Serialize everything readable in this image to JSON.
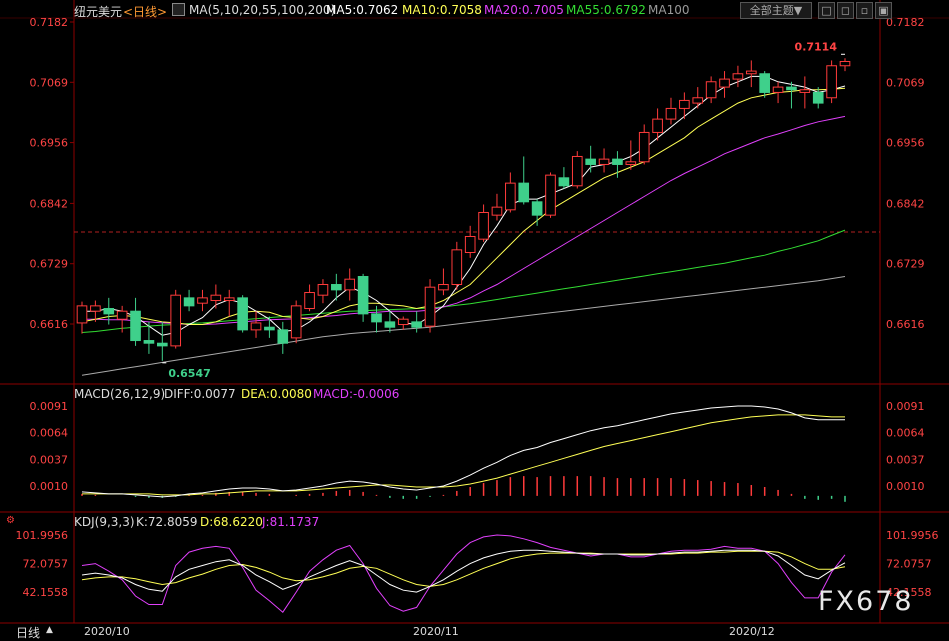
{
  "header": {
    "symbol_label": "纽元美元",
    "period_label": "<日线>",
    "ma_params": "MA(5,10,20,55,100,200)",
    "ma5": "MA5:0.7062",
    "ma10": "MA10:0.7058",
    "ma20": "MA20:0.7005",
    "ma55": "MA55:0.6792",
    "ma100": "MA100",
    "theme_button": "全部主题▼",
    "win_buttons": [
      "□",
      "◻",
      "▫",
      "▣"
    ]
  },
  "price_axis": [
    "0.7182",
    "0.7069",
    "0.6956",
    "0.6842",
    "0.6729",
    "0.6616"
  ],
  "annotations": {
    "high": "0.7114",
    "low": "0.6547"
  },
  "macd": {
    "title": "MACD(26,12,9)",
    "diff": "DIFF:0.0077",
    "dea": "DEA:0.0080",
    "macd": "MACD:-0.0006",
    "axis": [
      "0.0091",
      "0.0064",
      "0.0037",
      "0.0010"
    ]
  },
  "kdj": {
    "title": "KDJ(9,3,3)",
    "k": "K:72.8059",
    "d": "D:68.6220",
    "j": "J:81.1737",
    "axis": [
      "101.9956",
      "72.0757",
      "42.1558"
    ]
  },
  "bottom": {
    "period_tab": "日线",
    "dates": [
      "2020/10",
      "2020/11",
      "2020/12"
    ]
  },
  "watermark": "FX678",
  "colors": {
    "up": "#ff3b3b",
    "down": "#3fd08b",
    "ma5": "#ffffff",
    "ma10": "#ffff55",
    "ma20": "#e040fb",
    "ma55": "#33dd33",
    "ma100": "#aaaaaa"
  },
  "chart_data": {
    "type": "candlestick",
    "x_range": [
      "2020/10",
      "2020/12"
    ],
    "price_range": [
      0.6547,
      0.7182
    ],
    "candles": [
      {
        "o": 0.6618,
        "h": 0.6658,
        "l": 0.6598,
        "c": 0.665
      },
      {
        "o": 0.664,
        "h": 0.666,
        "l": 0.662,
        "c": 0.665
      },
      {
        "o": 0.6645,
        "h": 0.6665,
        "l": 0.6615,
        "c": 0.6635
      },
      {
        "o": 0.6625,
        "h": 0.665,
        "l": 0.66,
        "c": 0.664
      },
      {
        "o": 0.664,
        "h": 0.6665,
        "l": 0.6575,
        "c": 0.6585
      },
      {
        "o": 0.6585,
        "h": 0.662,
        "l": 0.656,
        "c": 0.658
      },
      {
        "o": 0.658,
        "h": 0.662,
        "l": 0.6547,
        "c": 0.6575
      },
      {
        "o": 0.6575,
        "h": 0.668,
        "l": 0.657,
        "c": 0.667
      },
      {
        "o": 0.6665,
        "h": 0.668,
        "l": 0.664,
        "c": 0.665
      },
      {
        "o": 0.6655,
        "h": 0.668,
        "l": 0.664,
        "c": 0.6665
      },
      {
        "o": 0.666,
        "h": 0.669,
        "l": 0.6645,
        "c": 0.667
      },
      {
        "o": 0.666,
        "h": 0.668,
        "l": 0.663,
        "c": 0.6665
      },
      {
        "o": 0.6665,
        "h": 0.667,
        "l": 0.66,
        "c": 0.6605
      },
      {
        "o": 0.6605,
        "h": 0.664,
        "l": 0.659,
        "c": 0.6618
      },
      {
        "o": 0.661,
        "h": 0.663,
        "l": 0.659,
        "c": 0.6605
      },
      {
        "o": 0.6605,
        "h": 0.662,
        "l": 0.656,
        "c": 0.658
      },
      {
        "o": 0.659,
        "h": 0.666,
        "l": 0.658,
        "c": 0.665
      },
      {
        "o": 0.6645,
        "h": 0.669,
        "l": 0.664,
        "c": 0.6675
      },
      {
        "o": 0.667,
        "h": 0.67,
        "l": 0.6655,
        "c": 0.669
      },
      {
        "o": 0.669,
        "h": 0.671,
        "l": 0.666,
        "c": 0.668
      },
      {
        "o": 0.668,
        "h": 0.672,
        "l": 0.666,
        "c": 0.67
      },
      {
        "o": 0.6705,
        "h": 0.671,
        "l": 0.662,
        "c": 0.6635
      },
      {
        "o": 0.6635,
        "h": 0.665,
        "l": 0.66,
        "c": 0.662
      },
      {
        "o": 0.662,
        "h": 0.664,
        "l": 0.66,
        "c": 0.661
      },
      {
        "o": 0.6615,
        "h": 0.663,
        "l": 0.6605,
        "c": 0.6625
      },
      {
        "o": 0.662,
        "h": 0.664,
        "l": 0.66,
        "c": 0.661
      },
      {
        "o": 0.6612,
        "h": 0.67,
        "l": 0.66,
        "c": 0.6685
      },
      {
        "o": 0.668,
        "h": 0.672,
        "l": 0.667,
        "c": 0.669
      },
      {
        "o": 0.669,
        "h": 0.677,
        "l": 0.668,
        "c": 0.6755
      },
      {
        "o": 0.675,
        "h": 0.68,
        "l": 0.674,
        "c": 0.678
      },
      {
        "o": 0.6775,
        "h": 0.684,
        "l": 0.677,
        "c": 0.6825
      },
      {
        "o": 0.682,
        "h": 0.686,
        "l": 0.681,
        "c": 0.6835
      },
      {
        "o": 0.683,
        "h": 0.69,
        "l": 0.6825,
        "c": 0.688
      },
      {
        "o": 0.688,
        "h": 0.693,
        "l": 0.684,
        "c": 0.6845
      },
      {
        "o": 0.6845,
        "h": 0.685,
        "l": 0.68,
        "c": 0.682
      },
      {
        "o": 0.682,
        "h": 0.69,
        "l": 0.6815,
        "c": 0.6895
      },
      {
        "o": 0.689,
        "h": 0.691,
        "l": 0.687,
        "c": 0.6875
      },
      {
        "o": 0.6875,
        "h": 0.694,
        "l": 0.687,
        "c": 0.693
      },
      {
        "o": 0.6925,
        "h": 0.695,
        "l": 0.69,
        "c": 0.6915
      },
      {
        "o": 0.6915,
        "h": 0.6945,
        "l": 0.69,
        "c": 0.6925
      },
      {
        "o": 0.6925,
        "h": 0.694,
        "l": 0.689,
        "c": 0.6915
      },
      {
        "o": 0.6915,
        "h": 0.696,
        "l": 0.6905,
        "c": 0.692
      },
      {
        "o": 0.692,
        "h": 0.699,
        "l": 0.6915,
        "c": 0.6975
      },
      {
        "o": 0.6975,
        "h": 0.702,
        "l": 0.696,
        "c": 0.7
      },
      {
        "o": 0.7,
        "h": 0.704,
        "l": 0.699,
        "c": 0.702
      },
      {
        "o": 0.702,
        "h": 0.705,
        "l": 0.7,
        "c": 0.7035
      },
      {
        "o": 0.703,
        "h": 0.706,
        "l": 0.702,
        "c": 0.704
      },
      {
        "o": 0.704,
        "h": 0.708,
        "l": 0.703,
        "c": 0.707
      },
      {
        "o": 0.706,
        "h": 0.709,
        "l": 0.704,
        "c": 0.7075
      },
      {
        "o": 0.7075,
        "h": 0.71,
        "l": 0.706,
        "c": 0.7085
      },
      {
        "o": 0.7085,
        "h": 0.711,
        "l": 0.706,
        "c": 0.709
      },
      {
        "o": 0.7085,
        "h": 0.709,
        "l": 0.704,
        "c": 0.705
      },
      {
        "o": 0.705,
        "h": 0.707,
        "l": 0.703,
        "c": 0.706
      },
      {
        "o": 0.706,
        "h": 0.707,
        "l": 0.702,
        "c": 0.7055
      },
      {
        "o": 0.705,
        "h": 0.708,
        "l": 0.702,
        "c": 0.7055
      },
      {
        "o": 0.705,
        "h": 0.706,
        "l": 0.702,
        "c": 0.703
      },
      {
        "o": 0.704,
        "h": 0.711,
        "l": 0.703,
        "c": 0.71
      },
      {
        "o": 0.71,
        "h": 0.7114,
        "l": 0.709,
        "c": 0.7108
      }
    ],
    "ma_lines": {
      "ma5": [
        0.664,
        0.664,
        0.6645,
        0.664,
        0.663,
        0.6612,
        0.6595,
        0.66,
        0.6615,
        0.6628,
        0.6652,
        0.6662,
        0.6655,
        0.664,
        0.6625,
        0.6602,
        0.6605,
        0.662,
        0.664,
        0.6665,
        0.6685,
        0.6675,
        0.666,
        0.664,
        0.6618,
        0.6615,
        0.663,
        0.665,
        0.6685,
        0.672,
        0.6765,
        0.68,
        0.684,
        0.685,
        0.685,
        0.686,
        0.687,
        0.688,
        0.691,
        0.6915,
        0.692,
        0.693,
        0.6945,
        0.6965,
        0.6985,
        0.7005,
        0.7025,
        0.7045,
        0.706,
        0.707,
        0.708,
        0.708,
        0.707,
        0.7065,
        0.706,
        0.705,
        0.7055,
        0.7062
      ],
      "ma10": [
        0.662,
        0.6625,
        0.663,
        0.6632,
        0.663,
        0.6625,
        0.662,
        0.6618,
        0.6615,
        0.6615,
        0.662,
        0.663,
        0.6638,
        0.664,
        0.6638,
        0.663,
        0.6628,
        0.6625,
        0.663,
        0.664,
        0.665,
        0.6655,
        0.6655,
        0.6652,
        0.665,
        0.6645,
        0.665,
        0.666,
        0.6675,
        0.669,
        0.6715,
        0.674,
        0.6765,
        0.679,
        0.681,
        0.683,
        0.6845,
        0.686,
        0.6875,
        0.689,
        0.69,
        0.691,
        0.692,
        0.6935,
        0.695,
        0.6965,
        0.6985,
        0.7,
        0.7015,
        0.703,
        0.704,
        0.7045,
        0.705,
        0.7052,
        0.7055,
        0.7055,
        0.7056,
        0.7058
      ],
      "ma20": [
        0.6625,
        0.6625,
        0.6624,
        0.6624,
        0.6622,
        0.662,
        0.6618,
        0.6617,
        0.6615,
        0.6615,
        0.6616,
        0.6618,
        0.662,
        0.6622,
        0.6624,
        0.6625,
        0.6626,
        0.6628,
        0.663,
        0.6632,
        0.6635,
        0.6637,
        0.6638,
        0.664,
        0.664,
        0.664,
        0.6642,
        0.6648,
        0.6655,
        0.6665,
        0.6678,
        0.669,
        0.6705,
        0.672,
        0.6735,
        0.675,
        0.6765,
        0.678,
        0.6795,
        0.681,
        0.6825,
        0.684,
        0.6855,
        0.687,
        0.6885,
        0.6898,
        0.691,
        0.6922,
        0.6935,
        0.6945,
        0.6955,
        0.6965,
        0.6972,
        0.698,
        0.6988,
        0.6995,
        0.7,
        0.7005
      ],
      "ma55": [
        0.66,
        0.6602,
        0.6605,
        0.6608,
        0.661,
        0.6612,
        0.6614,
        0.6615,
        0.6617,
        0.6618,
        0.662,
        0.6622,
        0.6624,
        0.6626,
        0.6628,
        0.663,
        0.6632,
        0.6634,
        0.6636,
        0.6638,
        0.664,
        0.6641,
        0.6642,
        0.6643,
        0.6644,
        0.6645,
        0.6646,
        0.6648,
        0.6651,
        0.6654,
        0.6658,
        0.6662,
        0.6666,
        0.667,
        0.6674,
        0.6678,
        0.6682,
        0.6686,
        0.669,
        0.6694,
        0.6698,
        0.6702,
        0.6706,
        0.671,
        0.6714,
        0.6718,
        0.6722,
        0.6726,
        0.673,
        0.6735,
        0.674,
        0.6745,
        0.6752,
        0.6758,
        0.6765,
        0.6772,
        0.6782,
        0.6792
      ],
      "ma100": [
        0.652,
        0.6524,
        0.6528,
        0.6532,
        0.6536,
        0.654,
        0.6544,
        0.6548,
        0.6552,
        0.6556,
        0.656,
        0.6564,
        0.6568,
        0.6572,
        0.6576,
        0.658,
        0.6584,
        0.6588,
        0.6592,
        0.6595,
        0.6598,
        0.66,
        0.6602,
        0.6604,
        0.6606,
        0.6608,
        0.661,
        0.6613,
        0.6616,
        0.6619,
        0.6622,
        0.6625,
        0.6628,
        0.6631,
        0.6634,
        0.6637,
        0.664,
        0.6643,
        0.6646,
        0.6649,
        0.6652,
        0.6655,
        0.6658,
        0.6661,
        0.6664,
        0.6667,
        0.667,
        0.6673,
        0.6676,
        0.6679,
        0.6682,
        0.6685,
        0.6688,
        0.6691,
        0.6694,
        0.6697,
        0.6701,
        0.6705
      ]
    },
    "macd_series": {
      "diff": [
        0.0004,
        0.0003,
        0.0002,
        0.0002,
        0.0001,
        0.0,
        -0.0001,
        0.0,
        0.0002,
        0.0003,
        0.0005,
        0.0007,
        0.0008,
        0.0008,
        0.0007,
        0.0005,
        0.0006,
        0.0008,
        0.001,
        0.0013,
        0.0015,
        0.0014,
        0.0012,
        0.0009,
        0.0007,
        0.0006,
        0.0008,
        0.001,
        0.0015,
        0.0021,
        0.0028,
        0.0034,
        0.0041,
        0.0046,
        0.0049,
        0.0054,
        0.0058,
        0.0062,
        0.0066,
        0.0069,
        0.0071,
        0.0074,
        0.0077,
        0.008,
        0.0083,
        0.0085,
        0.0087,
        0.0089,
        0.009,
        0.0091,
        0.0091,
        0.009,
        0.0088,
        0.0084,
        0.0079,
        0.0077,
        0.0077,
        0.0077
      ],
      "dea": [
        0.0002,
        0.0002,
        0.0002,
        0.0002,
        0.0002,
        0.0002,
        0.0001,
        0.0001,
        0.0001,
        0.0002,
        0.0002,
        0.0003,
        0.0004,
        0.0005,
        0.0005,
        0.0005,
        0.0005,
        0.0006,
        0.0007,
        0.0008,
        0.0009,
        0.001,
        0.0011,
        0.0011,
        0.001,
        0.0009,
        0.0009,
        0.0009,
        0.001,
        0.0012,
        0.0015,
        0.0018,
        0.0022,
        0.0026,
        0.003,
        0.0034,
        0.0038,
        0.0042,
        0.0046,
        0.005,
        0.0053,
        0.0056,
        0.0059,
        0.0062,
        0.0065,
        0.0068,
        0.0071,
        0.0074,
        0.0076,
        0.0078,
        0.008,
        0.0081,
        0.0082,
        0.0082,
        0.0082,
        0.0081,
        0.008,
        0.008
      ],
      "hist": [
        0.0002,
        0.0001,
        0.0,
        0.0,
        -0.0001,
        -0.0002,
        -0.0002,
        -0.0001,
        0.0001,
        0.0001,
        0.0003,
        0.0004,
        0.0004,
        0.0003,
        0.0002,
        0.0,
        0.0001,
        0.0002,
        0.0003,
        0.0005,
        0.0006,
        0.0004,
        0.0001,
        -0.0002,
        -0.0003,
        -0.0003,
        -0.0001,
        0.0001,
        0.0005,
        0.0009,
        0.0013,
        0.0016,
        0.0019,
        0.002,
        0.0019,
        0.002,
        0.002,
        0.002,
        0.002,
        0.0019,
        0.0018,
        0.0018,
        0.0018,
        0.0018,
        0.0018,
        0.0017,
        0.0016,
        0.0015,
        0.0014,
        0.0013,
        0.0011,
        0.0009,
        0.0006,
        0.0002,
        -0.0003,
        -0.0004,
        -0.0003,
        -0.0006
      ]
    },
    "kdj_series": {
      "k": [
        60,
        62,
        60,
        57,
        50,
        45,
        43,
        58,
        66,
        70,
        74,
        76,
        70,
        60,
        53,
        45,
        50,
        58,
        64,
        70,
        75,
        70,
        60,
        50,
        44,
        42,
        48,
        55,
        64,
        72,
        78,
        82,
        85,
        86,
        86,
        85,
        84,
        83,
        82,
        82,
        82,
        81,
        81,
        82,
        83,
        84,
        84,
        85,
        86,
        86,
        86,
        85,
        80,
        70,
        60,
        56,
        65,
        72.8059
      ],
      "d": [
        55,
        57,
        58,
        58,
        56,
        53,
        50,
        52,
        57,
        61,
        66,
        70,
        71,
        68,
        63,
        57,
        54,
        55,
        58,
        62,
        67,
        69,
        67,
        61,
        55,
        50,
        48,
        50,
        55,
        61,
        67,
        72,
        77,
        80,
        82,
        83,
        83,
        83,
        83,
        82,
        82,
        82,
        82,
        82,
        82,
        83,
        83,
        84,
        84,
        85,
        85,
        85,
        84,
        79,
        72,
        66,
        66,
        68.622
      ],
      "j": [
        70,
        72,
        64,
        55,
        38,
        29,
        29,
        70,
        84,
        88,
        90,
        88,
        68,
        44,
        33,
        21,
        42,
        64,
        76,
        86,
        91,
        72,
        46,
        28,
        22,
        26,
        48,
        65,
        82,
        94,
        100,
        102,
        101,
        98,
        94,
        89,
        86,
        83,
        80,
        82,
        82,
        79,
        79,
        82,
        85,
        86,
        86,
        87,
        90,
        88,
        88,
        85,
        72,
        52,
        36,
        36,
        63,
        81.1737
      ]
    }
  }
}
